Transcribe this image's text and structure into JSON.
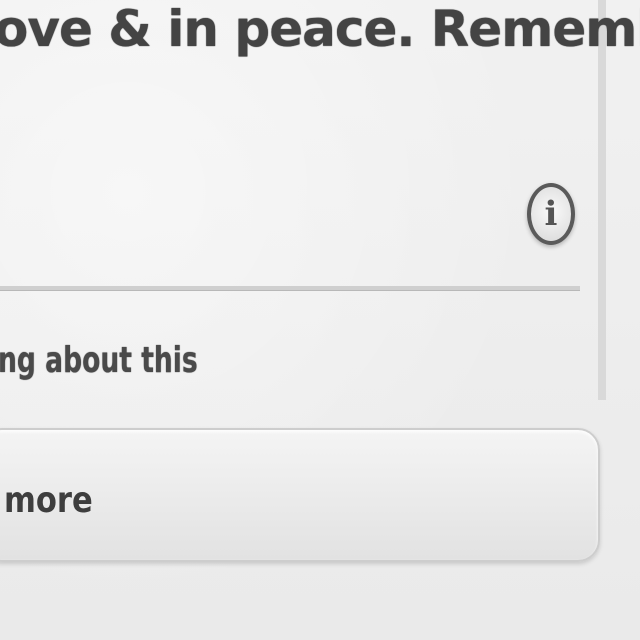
{
  "post": {
    "headline": "ove & in peace. Remember",
    "subtext": "ng about this"
  },
  "info_button": {
    "icon": "info-icon",
    "glyph": "i"
  },
  "more_button": {
    "label": "more"
  }
}
